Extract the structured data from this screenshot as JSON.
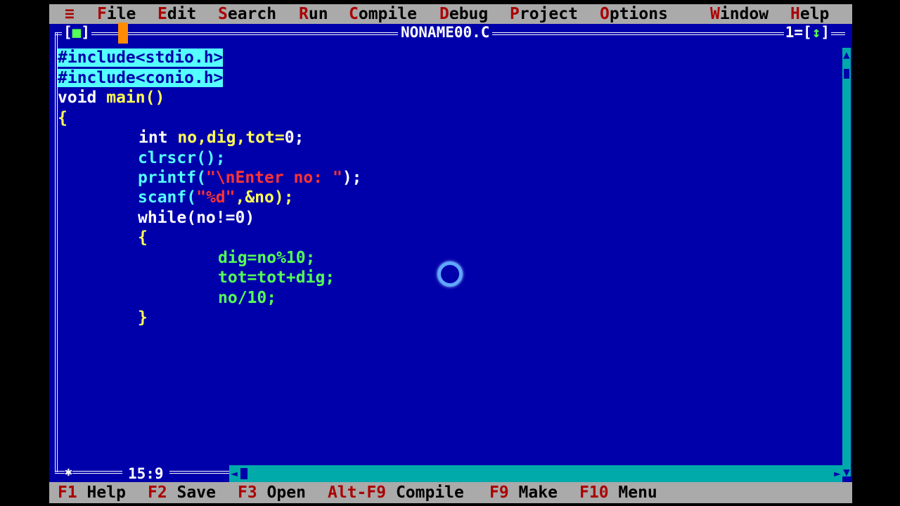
{
  "menu": [
    {
      "hot": "≡",
      "rest": ""
    },
    {
      "hot": "F",
      "rest": "ile"
    },
    {
      "hot": "E",
      "rest": "dit"
    },
    {
      "hot": "S",
      "rest": "earch"
    },
    {
      "hot": "R",
      "rest": "un"
    },
    {
      "hot": "C",
      "rest": "ompile"
    },
    {
      "hot": "D",
      "rest": "ebug"
    },
    {
      "hot": "P",
      "rest": "roject"
    },
    {
      "hot": "O",
      "rest": "ptions"
    },
    {
      "hot": "W",
      "rest": "indow"
    },
    {
      "hot": "H",
      "rest": "elp"
    }
  ],
  "editor": {
    "title": "NONAME00.C",
    "close_glyph": "■",
    "window_number": "1",
    "zoom_glyph": "↕",
    "cursor_position": "15:9",
    "corner_glyph": "✱"
  },
  "code": {
    "l1": "#include<stdio.h>",
    "l2": "#include<conio.h>",
    "l3_kw": "void",
    "l3_rest": " main()",
    "l4": "{",
    "l5_kw": "int",
    "l5_rest": " no,dig,tot=",
    "l5_num": "0",
    "l5_end": ";",
    "l6": "clrscr();",
    "l7_fn": "printf(",
    "l7_str": "\"\\nEnter no: \"",
    "l7_end": ");",
    "l8_fn": "scanf(",
    "l8_str": "\"%d\"",
    "l8_end": ",&no);",
    "l9": "while(no!=0)",
    "l10": "{",
    "l11": "dig=no%10;",
    "l12": "tot=tot+dig;",
    "l13": "no/10;",
    "l14": "}"
  },
  "status": [
    {
      "key": "F1",
      "label": " Help"
    },
    {
      "key": "F2",
      "label": " Save"
    },
    {
      "key": "F3",
      "label": " Open"
    },
    {
      "key": "Alt-F9",
      "label": " Compile"
    },
    {
      "key": "F9",
      "label": " Make"
    },
    {
      "key": "F10",
      "label": " Menu"
    }
  ],
  "colors": {
    "editor_bg": "#0000aa",
    "menu_bg": "#aaaaaa",
    "hotkey": "#aa0000",
    "preprocessor_highlight": "#55ffff",
    "string": "#ff3333"
  }
}
